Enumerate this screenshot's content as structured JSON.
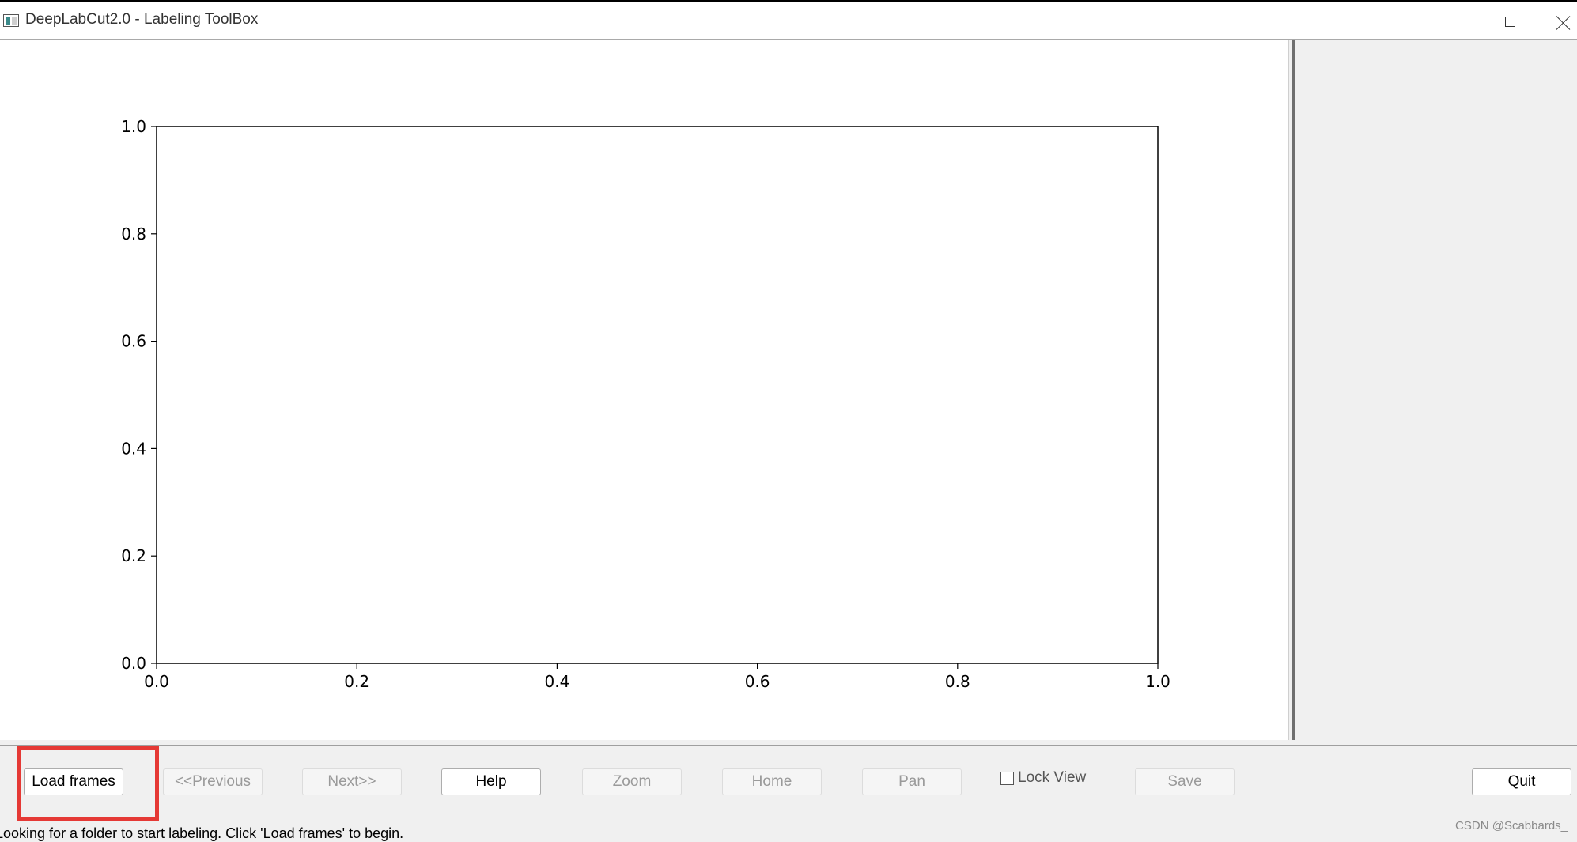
{
  "window": {
    "title": "DeepLabCut2.0 - Labeling ToolBox",
    "controls": [
      "minimize-icon",
      "maximize-icon",
      "close-icon"
    ]
  },
  "chart_data": {
    "type": "scatter",
    "series": [],
    "xlim": [
      0.0,
      1.0
    ],
    "ylim": [
      0.0,
      1.0
    ],
    "xticks": [
      "0.0",
      "0.2",
      "0.4",
      "0.6",
      "0.8",
      "1.0"
    ],
    "yticks": [
      "0.0",
      "0.2",
      "0.4",
      "0.6",
      "0.8",
      "1.0"
    ],
    "grid": false
  },
  "toolbar": {
    "load_frames": "Load frames",
    "previous": "<<Previous",
    "next": "Next>>",
    "help": "Help",
    "zoom": "Zoom",
    "home": "Home",
    "pan": "Pan",
    "lock_view": "Lock View",
    "save": "Save",
    "quit": "Quit"
  },
  "lock_view_checked": false,
  "status": "Looking for a folder to start labeling. Click 'Load frames' to begin.",
  "watermark": "CSDN @Scabbards_",
  "colors": {
    "highlight": "#e53935",
    "axes": "#000000",
    "background": "#f0f0f0"
  }
}
